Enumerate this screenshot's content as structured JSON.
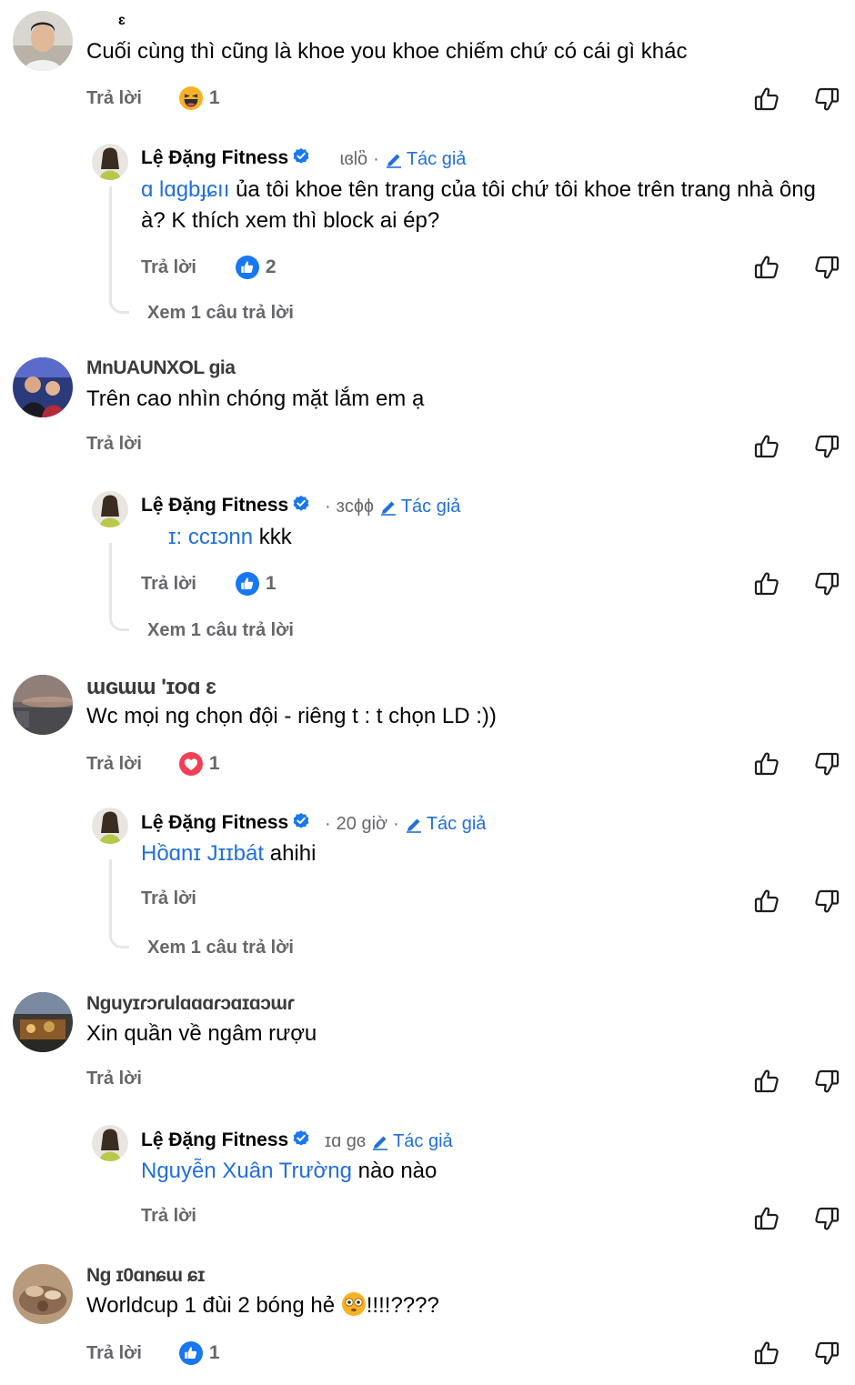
{
  "comments": [
    {
      "author": "ɛ",
      "text": "Cuối cùng thì cũng là khoe you khoe chiếm chứ có cái gì khác",
      "reply_label": "Trả lời",
      "reaction_count": "1",
      "reaction_icon": "laugh-emoji-icon",
      "reply": {
        "author": "Lệ Đặng Fitness",
        "time": "ɩɞlὃ",
        "tag": "Tác giả",
        "mention": "ɑ lɑgbɟɕıı",
        "text": " ủa tôi khoe tên trang của tôi chứ tôi khoe trên trang nhà ông à? K thích xem thì block ai ép?",
        "reply_label": "Trả lời",
        "reaction_count": "2",
        "reaction_icon": "like-icon",
        "see_more": "Xem 1 câu trả lời"
      }
    },
    {
      "author": "MnUAUNXOL gia",
      "text": "Trên cao nhìn chóng mặt lắm em ạ",
      "reply_label": "Trả lời",
      "reply": {
        "author": "Lệ Đặng Fitness",
        "time": "ɜcɸɸ",
        "tag": "Tác giả",
        "mention": "ɪ: ccɪɔnn",
        "text": " kkk",
        "reply_label": "Trả lời",
        "reaction_count": "1",
        "reaction_icon": "like-icon",
        "see_more": "Xem 1 câu trả lời"
      }
    },
    {
      "author": "ɯɢɯɯ 'ɪoɑ ɛ",
      "text": "Wc mọi ng chọn đội - riêng t : t chọn LD :))",
      "reply_label": "Trả lời",
      "reaction_count": "1",
      "reaction_icon": "love-icon",
      "reply": {
        "author": "Lệ Đặng Fitness",
        "time": "20 giờ",
        "tag": "Tác giả",
        "mention": "Hồɑnɪ Jɪɪbát",
        "text": " ahihi",
        "reply_label": "Trả lời",
        "see_more": "Xem 1 câu trả lời"
      }
    },
    {
      "author": "Nguyɪɾɔɾulɑɑɑɾɔɑɪɑɔɯɾ",
      "text": "Xin quần về ngâm rượu",
      "reply_label": "Trả lời",
      "reply": {
        "author": "Lệ Đặng Fitness",
        "time": "ɪɑ ɡɞ",
        "tag": "Tác giả",
        "mention": "Nguyễn Xuân Trường",
        "text": " nào nào",
        "reply_label": "Trả lời"
      }
    },
    {
      "author": "Ng ɪ0ɑnɕɯ ɕɪ",
      "text": "Worldcup 1 đùi 2 bóng hẻ",
      "text_tail": "!!!!????",
      "reply_label": "Trả lời",
      "reaction_count": "1",
      "reaction_icon": "like-icon"
    }
  ],
  "icons": {
    "upvote": "thumbs-up-outline-icon",
    "downvote": "thumbs-down-outline-icon",
    "verified": "verified-badge-icon",
    "author_tag": "pencil-icon"
  },
  "colors": {
    "accent": "#216fdb",
    "secondary_text": "#65676b",
    "love": "#f33e58",
    "verified": "#1877f2"
  }
}
